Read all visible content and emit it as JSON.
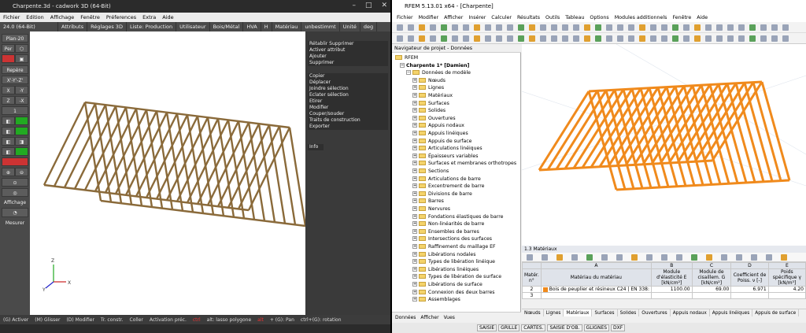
{
  "cadwork": {
    "title": "Charpente.3d - cadwork 3D (64-Bit)",
    "menu": [
      "Fichier",
      "Edition",
      "Affichage",
      "Fenêtre",
      "Préferences",
      "Extra",
      "Aide"
    ],
    "version": "24.0 (64-Bit)",
    "toolbar": [
      "Attributs",
      "Réglages 3D",
      "Liste: Production",
      "Utilisateur",
      "Bois/Métal",
      "HVA",
      "H",
      "Matériau",
      "unbestimmt",
      "Unité",
      "deg"
    ],
    "left": [
      "Plan-20",
      "Per",
      "Repère",
      "X'-Y'-Z'",
      "X",
      "-Y",
      "Z",
      "-X",
      "1",
      "Affichage",
      "Mesurer"
    ],
    "right": [
      "Rétablir Supprimer",
      "Activer attribut",
      "Ajouter",
      "Supprimer",
      "Copier",
      "Déplacer",
      "Joindre sélection",
      "Eclater sélection",
      "Etirer",
      "Modifier",
      "Couper/souder",
      "Traits de construction",
      "Exporter",
      "Info"
    ],
    "status": [
      "(G) Activer",
      "(M) Glisser",
      "(D) Modifier",
      "Tr. constr.",
      "Coller",
      "Activation préc.",
      "ctrl",
      "alt: lasso polygone",
      "alt",
      "+ (G): Pan",
      "ctrl+(G): rotation"
    ]
  },
  "rfem": {
    "title": "RFEM 5.13.01 x64 - [Charpente]",
    "menu": [
      "Fichier",
      "Modifier",
      "Afficher",
      "Insérer",
      "Calculer",
      "Résultats",
      "Outils",
      "Tableau",
      "Options",
      "Modules additionnels",
      "Fenêtre",
      "Aide"
    ],
    "nav_title": "Navigateur de projet - Données",
    "tree_root": "RFEM",
    "tree_project": "Charpente 1* [Damien]",
    "tree_data": "Données de modèle",
    "tree_items": [
      "Nœuds",
      "Lignes",
      "Matériaux",
      "Surfaces",
      "Solides",
      "Ouvertures",
      "Appuis nodaux",
      "Appuis linéiques",
      "Appuis de surface",
      "Articulations linéiques",
      "Épaisseurs variables",
      "Surfaces et membranes orthotropes",
      "Sections",
      "Articulations de barre",
      "Excentrement de barre",
      "Divisions de barre",
      "Barres",
      "Nervures",
      "Fondations élastiques de barre",
      "Non-linéarités de barre",
      "Ensembles de barres",
      "Intersections des surfaces",
      "Raffinement du maillage EF",
      "Libérations nodales",
      "Types de libération linéique",
      "Libérations linéiques",
      "Types de libération de surface",
      "Libérations de surface",
      "Connexion des deux barres",
      "Assemblages"
    ],
    "nav_tabs": [
      "Données",
      "Afficher",
      "Vues"
    ],
    "table_title": "1.3 Matériaux",
    "table_cols": [
      "A",
      "B",
      "C",
      "D",
      "E"
    ],
    "table_head": [
      "Matér. n°",
      "Matériau du matériau",
      "Module d'élasticité E [kN/cm²]",
      "Module de cisaillem. G [kN/cm²]",
      "Coefficient de Poiss. ν [-]",
      "Poids spécifique γ [kN/m³]"
    ],
    "table_rows": [
      {
        "n": "2",
        "name": "Bois de peuplier et résineux C24 | EN 338:",
        "e": "1100.00",
        "g": "69.00",
        "nu": "6.971",
        "gamma": "4.20"
      },
      {
        "n": "3",
        "name": "",
        "e": "",
        "g": "",
        "nu": "",
        "gamma": ""
      }
    ],
    "tabs": [
      "Nœuds",
      "Lignes",
      "Matériaux",
      "Surfaces",
      "Solides",
      "Ouvertures",
      "Appuis nodaux",
      "Appuis linéiques",
      "Appuis de surface"
    ],
    "status": [
      "SAISIE",
      "GRILLE",
      "CARTES.",
      "SAISIE D'OB.",
      "GLIGNES",
      "DXF"
    ],
    "color_member": "#f08a1c"
  }
}
